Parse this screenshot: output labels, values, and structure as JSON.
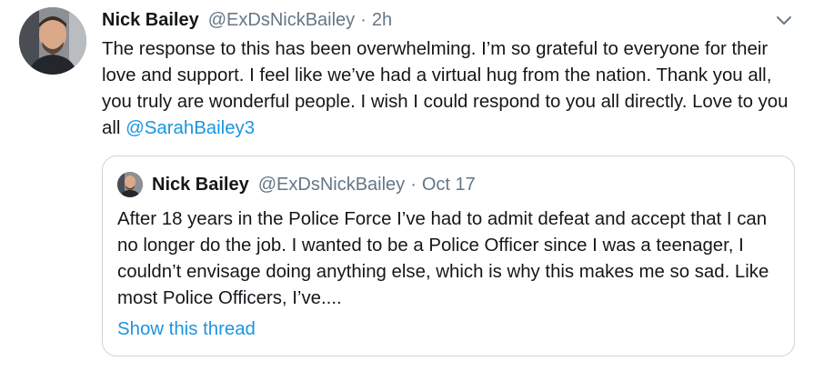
{
  "tweet": {
    "name": "Nick Bailey",
    "handle": "@ExDsNickBailey",
    "separator": "·",
    "time": "2h",
    "text": "The response to this has been overwhelming. I’m so grateful to everyone for their love and support. I feel like we’ve had a virtual hug from the nation. Thank you all, you truly are wonderful people. I wish I could respond to you all directly. Love to you all ",
    "mention": "@SarahBailey3"
  },
  "quoted": {
    "name": "Nick Bailey",
    "handle": "@ExDsNickBailey",
    "separator": "·",
    "time": "Oct 17",
    "text": "After 18 years in the Police Force I’ve had to admit defeat and accept that I can no longer do the job. I wanted to be a Police Officer since I was a teenager, I couldn’t envisage doing anything else, which is why this makes me so sad. Like most Police Officers, I’ve....",
    "show_thread": "Show this thread"
  },
  "icons": {
    "caret": "chevron-down-icon",
    "avatar": "avatar",
    "quoted_avatar": "avatar"
  },
  "colors": {
    "text": "#14171a",
    "secondary": "#657786",
    "link": "#1b95e0",
    "border": "#ccd6dd"
  }
}
